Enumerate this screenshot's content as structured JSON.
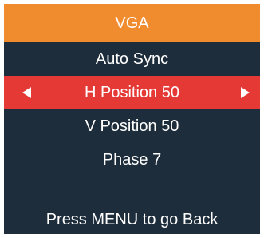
{
  "colors": {
    "panel_background": "#1e2d3b",
    "header_background": "#f08c2e",
    "selected_background": "#e53935",
    "text": "#ffffff"
  },
  "osd": {
    "title": "VGA",
    "items": [
      {
        "label": "Auto Sync",
        "selected": false
      },
      {
        "label": "H Position 50",
        "selected": true
      },
      {
        "label": "V Position 50",
        "selected": false
      },
      {
        "label": "Phase 7",
        "selected": false
      }
    ],
    "arrows": {
      "left_icon": "triangle-left-icon",
      "right_icon": "triangle-right-icon"
    },
    "footer": "Press MENU to go Back"
  }
}
